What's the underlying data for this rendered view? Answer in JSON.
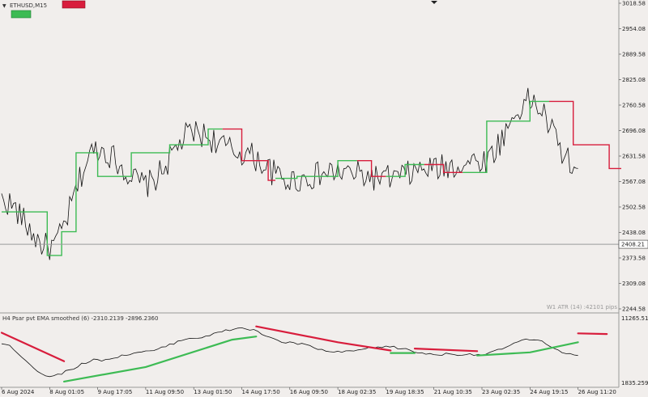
{
  "window": {
    "symbol_label": "ETHUSD,M15"
  },
  "badges": {
    "red_badge": "",
    "green_badge": ""
  },
  "main_panel": {
    "atr_label": "W1 ATR (14) :42101 pips",
    "current_price_label": "2408.21",
    "price_axis": [
      "3018.58",
      "2954.08",
      "2889.58",
      "2825.08",
      "2760.58",
      "2696.08",
      "2631.58",
      "2567.08",
      "2502.58",
      "2438.08",
      "2373.58",
      "2309.08",
      "2244.58"
    ]
  },
  "sub_panel": {
    "title": "H4 Psar pvt EMA smoothed (6) -2310.2139 -2896.2360",
    "axis_top": "11265.517",
    "axis_bottom": "1835.2598"
  },
  "x_axis": {
    "labels": [
      "6 Aug 2024",
      "8 Aug 01:05",
      "9 Aug 17:05",
      "11 Aug 09:50",
      "13 Aug 01:50",
      "14 Aug 17:50",
      "16 Aug 09:50",
      "18 Aug 02:35",
      "19 Aug 18:35",
      "21 Aug 10:35",
      "23 Aug 02:35",
      "24 Aug 19:15",
      "26 Aug 11:20"
    ]
  },
  "colors": {
    "bull": "#3dbb54",
    "bear": "#d81d3c",
    "price": "#111111",
    "background": "#f1eeec"
  },
  "chart_data": {
    "type": "line",
    "title": "ETHUSD,M15",
    "ylim": [
      2244.58,
      3018.58
    ],
    "current_price": 2408.21,
    "x": [
      "6 Aug 2024",
      "8 Aug 01:05",
      "9 Aug 17:05",
      "11 Aug 09:50",
      "13 Aug 01:50",
      "14 Aug 17:50",
      "16 Aug 09:50",
      "18 Aug 02:35",
      "19 Aug 18:35",
      "21 Aug 10:35",
      "23 Aug 02:35",
      "24 Aug 19:15",
      "26 Aug 11:20"
    ],
    "series": [
      {
        "values": [
          2520,
          2400,
          2650,
          2560,
          2690,
          2640,
          2570,
          2590,
          2575,
          2600,
          2620,
          2770,
          2600
        ]
      }
    ],
    "stop_levels": [
      {
        "side": "bull",
        "points": [
          [
            0,
            2490
          ],
          [
            0.9,
            2490
          ],
          [
            1.0,
            2380
          ],
          [
            1.5,
            2440
          ],
          [
            1.6,
            2640
          ],
          [
            2.4,
            2580
          ],
          [
            3.0,
            2640
          ],
          [
            4.0,
            2660
          ],
          [
            4.6,
            2700
          ]
        ]
      },
      {
        "side": "bear",
        "points": [
          [
            4.6,
            2700
          ],
          [
            5.4,
            2620
          ],
          [
            5.7,
            2570
          ]
        ]
      },
      {
        "side": "bull",
        "points": [
          [
            5.7,
            2575
          ],
          [
            6.6,
            2580
          ],
          [
            7.4,
            2620
          ]
        ]
      },
      {
        "side": "bear",
        "points": [
          [
            7.4,
            2620
          ],
          [
            8.0,
            2580
          ]
        ]
      },
      {
        "side": "bull",
        "points": [
          [
            8.0,
            2580
          ],
          [
            8.8,
            2610
          ]
        ]
      },
      {
        "side": "bear",
        "points": [
          [
            8.8,
            2610
          ],
          [
            9.6,
            2590
          ]
        ]
      },
      {
        "side": "bull",
        "points": [
          [
            9.6,
            2590
          ],
          [
            10.6,
            2720
          ],
          [
            11.4,
            2770
          ]
        ]
      },
      {
        "side": "bear",
        "points": [
          [
            11.4,
            2770
          ],
          [
            12.4,
            2660
          ],
          [
            12.9,
            2600
          ]
        ]
      }
    ],
    "sub_ylim": [
      1835.2598,
      11265.517
    ],
    "sub_series": [
      {
        "values": [
          8000,
          3000,
          5500,
          6800,
          9000,
          10500,
          8200,
          6700,
          7600,
          6400,
          6400,
          8700,
          6200
        ]
      }
    ],
    "sub_bands": [
      {
        "side": "bear",
        "points": [
          [
            0,
            9800
          ],
          [
            1.3,
            5300
          ]
        ]
      },
      {
        "side": "bull",
        "points": [
          [
            1.3,
            2100
          ],
          [
            3.0,
            4400
          ],
          [
            4.8,
            8700
          ],
          [
            5.3,
            9200
          ]
        ]
      },
      {
        "side": "bear",
        "points": [
          [
            5.3,
            10800
          ],
          [
            7.0,
            8300
          ],
          [
            8.1,
            7000
          ]
        ]
      },
      {
        "side": "bull",
        "points": [
          [
            8.1,
            6600
          ],
          [
            8.6,
            6600
          ]
        ]
      },
      {
        "side": "bear",
        "points": [
          [
            8.6,
            7300
          ],
          [
            9.9,
            6900
          ]
        ]
      },
      {
        "side": "bull",
        "points": [
          [
            9.9,
            6200
          ],
          [
            11.0,
            6700
          ],
          [
            12.0,
            8300
          ]
        ]
      },
      {
        "side": "bear",
        "points": [
          [
            12.0,
            9700
          ],
          [
            12.6,
            9600
          ]
        ]
      }
    ]
  }
}
